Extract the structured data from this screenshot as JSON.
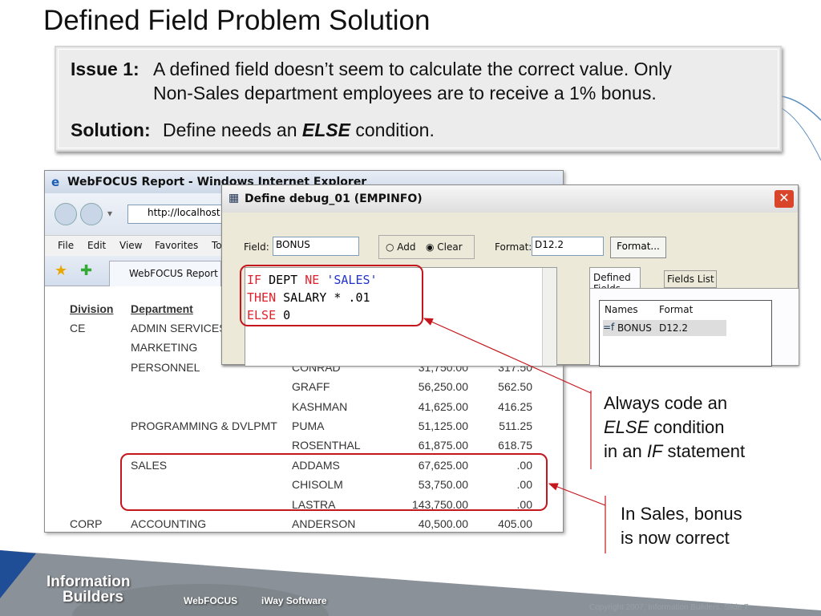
{
  "slide": {
    "title": "Defined Field Problem Solution",
    "issue_label": "Issue 1:",
    "issue_line1": "A defined field doesn’t seem to calculate the correct value. Only",
    "issue_line2": "Non-Sales department employees are to receive a 1% bonus.",
    "solution_label": "Solution:",
    "solution_pre": "Define needs an",
    "solution_em": "ELSE",
    "solution_post": "condition.",
    "callout1": {
      "l1": "Always code an",
      "l2_em": "ELSE",
      "l2": "condition",
      "l3_pre": "in an",
      "l3_em": "IF",
      "l3": "statement"
    },
    "callout2": {
      "l1": "In Sales, bonus",
      "l2": "is now correct"
    },
    "accent": "#c4161c"
  },
  "browser": {
    "title": "WebFOCUS Report - Windows Internet Explorer",
    "address": "http://localhost:",
    "menu": [
      "File",
      "Edit",
      "View",
      "Favorites",
      "To"
    ],
    "tab": "WebFOCUS Report",
    "headers": [
      "Division",
      "Department"
    ],
    "rows": [
      [
        "CE",
        "ADMIN SERVICES",
        "",
        "",
        ""
      ],
      [
        "",
        "MARKETING",
        "",
        "",
        ""
      ],
      [
        "",
        "PERSONNEL",
        "CONRAD",
        "31,750.00",
        "317.50"
      ],
      [
        "",
        "",
        "GRAFF",
        "56,250.00",
        "562.50"
      ],
      [
        "",
        "",
        "KASHMAN",
        "41,625.00",
        "416.25"
      ],
      [
        "",
        "PROGRAMMING & DVLPMT",
        "PUMA",
        "51,125.00",
        "511.25"
      ],
      [
        "",
        "",
        "ROSENTHAL",
        "61,875.00",
        "618.75"
      ],
      [
        "",
        "SALES",
        "ADDAMS",
        "67,625.00",
        ".00"
      ],
      [
        "",
        "",
        "CHISOLM",
        "53,750.00",
        ".00"
      ],
      [
        "",
        "",
        "LASTRA",
        "143,750.00",
        ".00"
      ],
      [
        "CORP",
        "ACCOUNTING",
        "ANDERSON",
        "40,500.00",
        "405.00"
      ]
    ]
  },
  "dialog": {
    "title": "Define debug_01 (EMPINFO)",
    "field_label": "Field:",
    "field_value": "BONUS",
    "add": "Add",
    "clear": "Clear",
    "mode": "Clear",
    "format_label": "Format:",
    "format_value": "D12.2",
    "format_button": "Format...",
    "code": {
      "l1": [
        "IF",
        " DEPT ",
        "NE",
        " 'SALES'"
      ],
      "l2": [
        "THEN",
        " SALARY * .01"
      ],
      "l3": [
        "ELSE",
        " 0"
      ]
    },
    "tabs": [
      "Defined Fields",
      "Fields List"
    ],
    "list_headers": [
      "Names",
      "Format"
    ],
    "list_rows": [
      [
        "BONUS",
        "D12.2"
      ]
    ]
  },
  "footer": {
    "logo_l1": "Information",
    "logo_l2": "Builders",
    "link1": "WebFOCUS",
    "link2": "iWay Software",
    "copyright": "Copyright 2007, Information Builders. Slide 7"
  }
}
